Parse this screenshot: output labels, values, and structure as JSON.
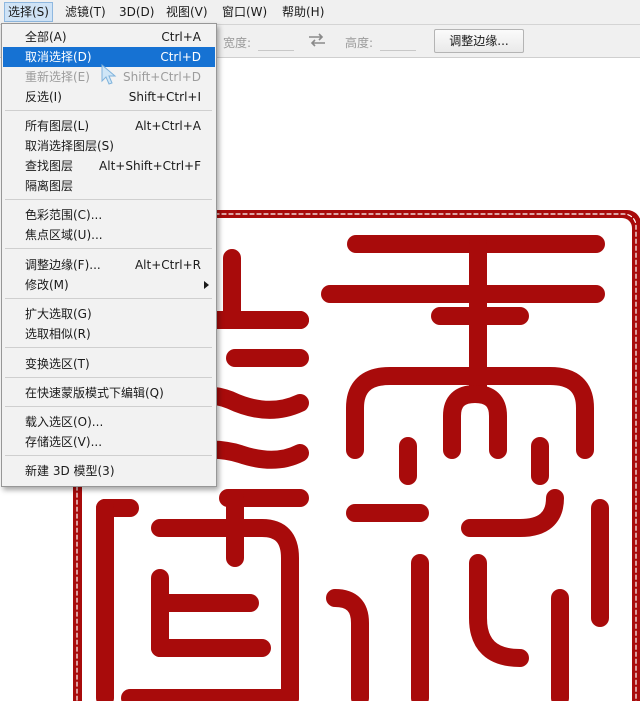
{
  "menubar": {
    "items": [
      {
        "label": "选择(S)"
      },
      {
        "label": "滤镜(T)"
      },
      {
        "label": "3D(D)"
      },
      {
        "label": "视图(V)"
      },
      {
        "label": "窗口(W)"
      },
      {
        "label": "帮助(H)"
      }
    ]
  },
  "options": {
    "width_label": "宽度:",
    "height_label": "高度:",
    "refine_button": "调整边缘..."
  },
  "select_menu": {
    "items": [
      {
        "label": "全部(A)",
        "shortcut": "Ctrl+A"
      },
      {
        "label": "取消选择(D)",
        "shortcut": "Ctrl+D"
      },
      {
        "label": "重新选择(E)",
        "shortcut": "Shift+Ctrl+D"
      },
      {
        "label": "反选(I)",
        "shortcut": "Shift+Ctrl+I"
      },
      {
        "label": "所有图层(L)",
        "shortcut": "Alt+Ctrl+A"
      },
      {
        "label": "取消选择图层(S)",
        "shortcut": ""
      },
      {
        "label": "查找图层",
        "shortcut": "Alt+Shift+Ctrl+F"
      },
      {
        "label": "隔离图层",
        "shortcut": ""
      },
      {
        "label": "色彩范围(C)...",
        "shortcut": ""
      },
      {
        "label": "焦点区域(U)...",
        "shortcut": ""
      },
      {
        "label": "调整边缘(F)...",
        "shortcut": "Alt+Ctrl+R"
      },
      {
        "label": "修改(M)",
        "shortcut": ""
      },
      {
        "label": "扩大选取(G)",
        "shortcut": ""
      },
      {
        "label": "选取相似(R)",
        "shortcut": ""
      },
      {
        "label": "变换选区(T)",
        "shortcut": ""
      },
      {
        "label": "在快速蒙版模式下编辑(Q)",
        "shortcut": ""
      },
      {
        "label": "载入选区(O)...",
        "shortcut": ""
      },
      {
        "label": "存储选区(V)...",
        "shortcut": ""
      },
      {
        "label": "新建 3D 模型(3)",
        "shortcut": ""
      }
    ]
  },
  "colors": {
    "seal_red": "#a80b0b",
    "highlight": "#1672d3",
    "menu_bg": "#f2f2f2"
  },
  "icons": {
    "swap": "swap-arrows-icon",
    "submenu": "submenu-arrow-icon",
    "cursor": "mouse-pointer-icon"
  }
}
